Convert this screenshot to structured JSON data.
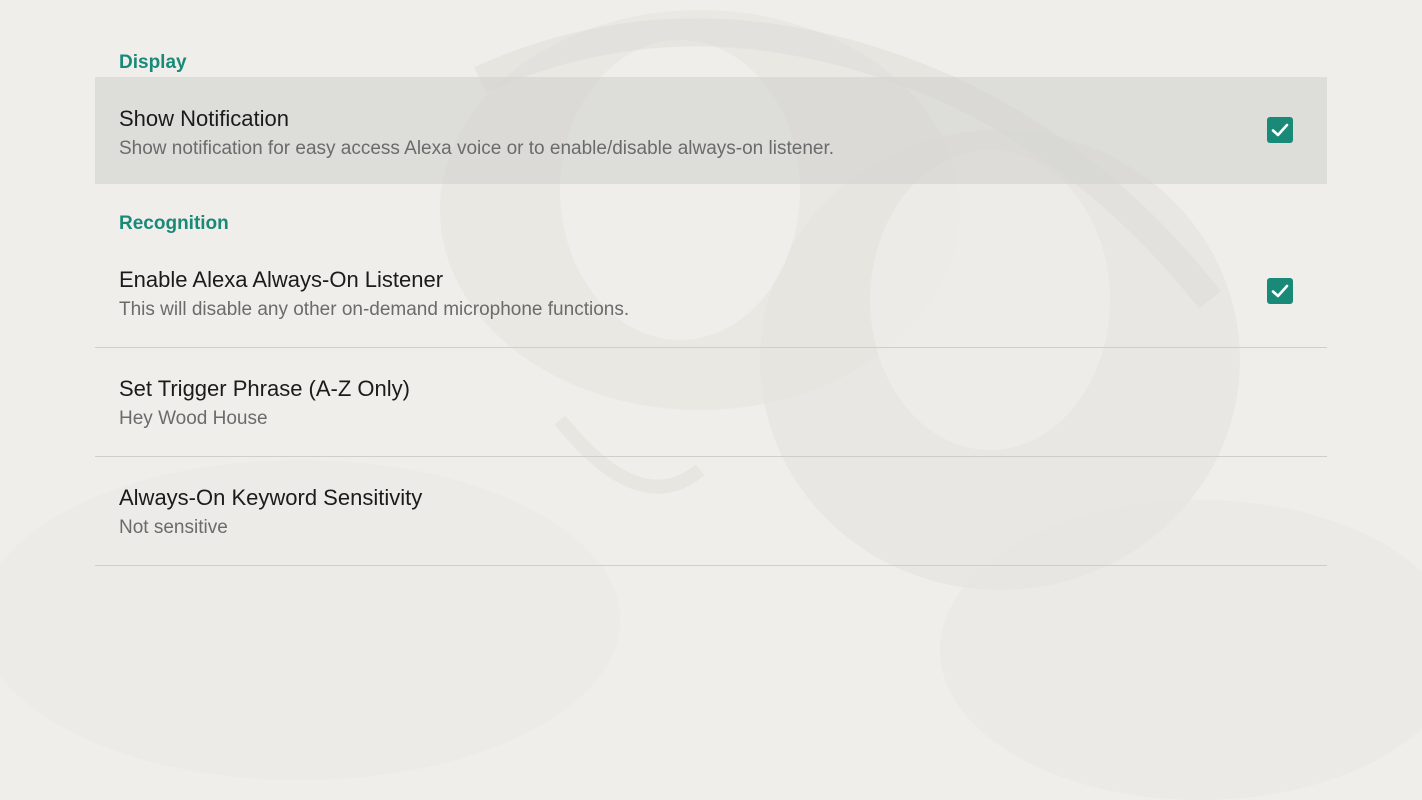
{
  "settings": {
    "categories": [
      {
        "title": "Display",
        "items": [
          {
            "title": "Show Notification",
            "summary": "Show notification for easy access Alexa voice or to enable/disable always-on listener.",
            "checked": true
          }
        ]
      },
      {
        "title": "Recognition",
        "items": [
          {
            "title": "Enable Alexa Always-On Listener",
            "summary": "This will disable any other on-demand microphone functions.",
            "checked": true
          },
          {
            "title": "Set Trigger Phrase (A-Z Only)",
            "summary": "Hey Wood House"
          },
          {
            "title": "Always-On Keyword Sensitivity",
            "summary": "Not sensitive"
          }
        ]
      }
    ]
  },
  "colors": {
    "accent": "#1a8a78",
    "background": "#efeeea",
    "title_text": "#1b1b1b",
    "summary_text": "#6b6b6b"
  },
  "icons": {
    "checkbox_checked": "check-icon"
  }
}
